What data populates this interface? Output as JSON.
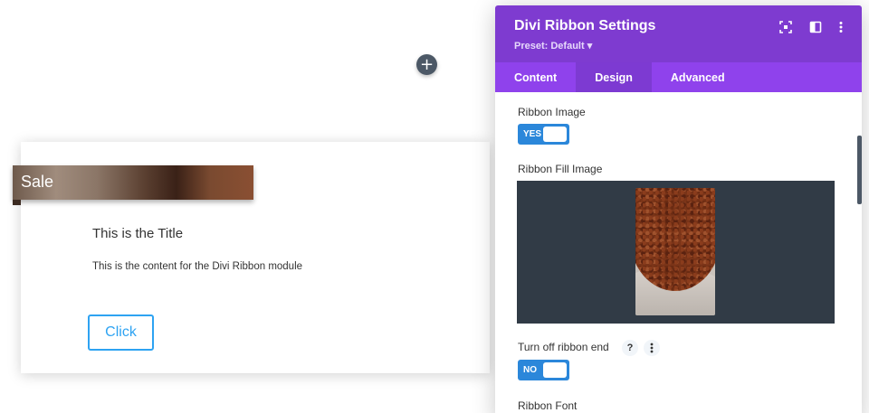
{
  "canvas": {
    "add_symbol": "+",
    "ribbon_text": "Sale",
    "title": "This is the Title",
    "content": "This is the content for the Divi Ribbon module",
    "button_label": "Click"
  },
  "panel": {
    "title": "Divi Ribbon Settings",
    "preset": "Preset: Default ▾",
    "header_icons": [
      "expand-icon",
      "split-view-icon",
      "more-options-icon"
    ],
    "tabs": [
      {
        "label": "Content",
        "active": false
      },
      {
        "label": "Design",
        "active": true
      },
      {
        "label": "Advanced",
        "active": false
      }
    ],
    "fields": {
      "ribbon_image_label": "Ribbon Image",
      "ribbon_image_value": "YES",
      "ribbon_fill_image_label": "Ribbon Fill Image",
      "ribbon_end_label": "Turn off ribbon end",
      "ribbon_end_help": "?",
      "ribbon_end_value": "NO",
      "ribbon_font_label": "Ribbon Font"
    }
  },
  "colors": {
    "header": "#7e3bd0",
    "tabs": "#8f42ec",
    "toggle": "#2b87da",
    "button_text": "#2ea3f2"
  }
}
